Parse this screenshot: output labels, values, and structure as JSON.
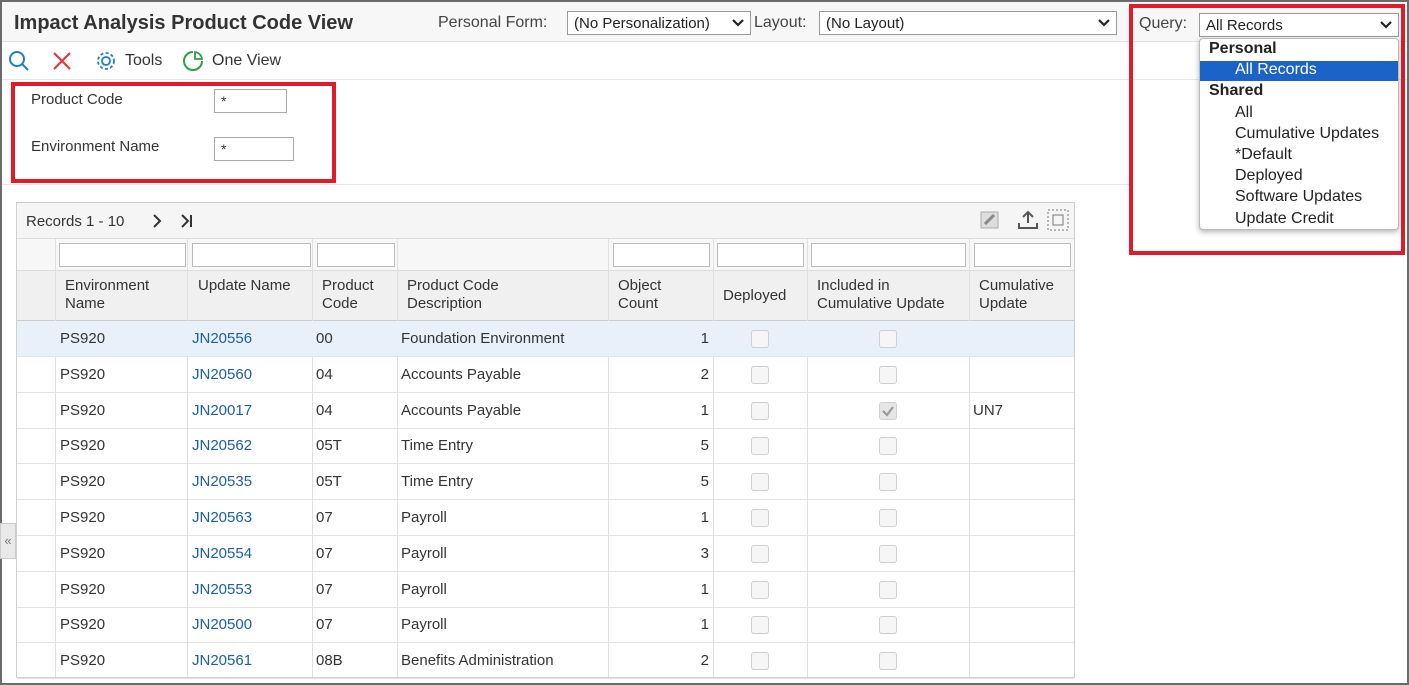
{
  "header": {
    "title": "Impact Analysis Product Code View",
    "personal_form_label": "Personal Form:",
    "personal_form_value": "(No Personalization)",
    "layout_label": "Layout:",
    "layout_value": "(No Layout)",
    "query_label": "Query:",
    "query_value": "All Records"
  },
  "toolbar": {
    "tools_label": "Tools",
    "one_view_label": "One View"
  },
  "form": {
    "product_code_label": "Product Code",
    "product_code_value": "*",
    "environment_name_label": "Environment Name",
    "environment_name_value": "*"
  },
  "grid": {
    "records_label": "Records 1 - 10",
    "columns": [
      "Environment Name",
      "Update Name",
      "Product Code",
      "Product Code Description",
      "Object Count",
      "Deployed",
      "Included in Cumulative Update",
      "Cumulative Update"
    ],
    "rows": [
      {
        "env": "PS920",
        "update": "JN20556",
        "code": "00",
        "desc": "Foundation Environment",
        "count": "1",
        "deployed": false,
        "included": false,
        "cumulative": ""
      },
      {
        "env": "PS920",
        "update": "JN20560",
        "code": "04",
        "desc": "Accounts Payable",
        "count": "2",
        "deployed": false,
        "included": false,
        "cumulative": ""
      },
      {
        "env": "PS920",
        "update": "JN20017",
        "code": "04",
        "desc": "Accounts Payable",
        "count": "1",
        "deployed": false,
        "included": true,
        "cumulative": "UN7"
      },
      {
        "env": "PS920",
        "update": "JN20562",
        "code": "05T",
        "desc": "Time Entry",
        "count": "5",
        "deployed": false,
        "included": false,
        "cumulative": ""
      },
      {
        "env": "PS920",
        "update": "JN20535",
        "code": "05T",
        "desc": "Time Entry",
        "count": "5",
        "deployed": false,
        "included": false,
        "cumulative": ""
      },
      {
        "env": "PS920",
        "update": "JN20563",
        "code": "07",
        "desc": "Payroll",
        "count": "1",
        "deployed": false,
        "included": false,
        "cumulative": ""
      },
      {
        "env": "PS920",
        "update": "JN20554",
        "code": "07",
        "desc": "Payroll",
        "count": "3",
        "deployed": false,
        "included": false,
        "cumulative": ""
      },
      {
        "env": "PS920",
        "update": "JN20553",
        "code": "07",
        "desc": "Payroll",
        "count": "1",
        "deployed": false,
        "included": false,
        "cumulative": ""
      },
      {
        "env": "PS920",
        "update": "JN20500",
        "code": "07",
        "desc": "Payroll",
        "count": "1",
        "deployed": false,
        "included": false,
        "cumulative": ""
      },
      {
        "env": "PS920",
        "update": "JN20561",
        "code": "08B",
        "desc": "Benefits Administration",
        "count": "2",
        "deployed": false,
        "included": false,
        "cumulative": ""
      }
    ]
  },
  "query_menu": {
    "personal_group": "Personal",
    "personal_items": [
      "All Records"
    ],
    "shared_group": "Shared",
    "shared_items": [
      "All",
      "Cumulative Updates",
      "*Default",
      "Deployed",
      "Software Updates",
      "Update Credit"
    ]
  },
  "colors": {
    "highlight": "#e01b2a",
    "selection": "#1c63c7",
    "link": "#1a5fa8"
  }
}
